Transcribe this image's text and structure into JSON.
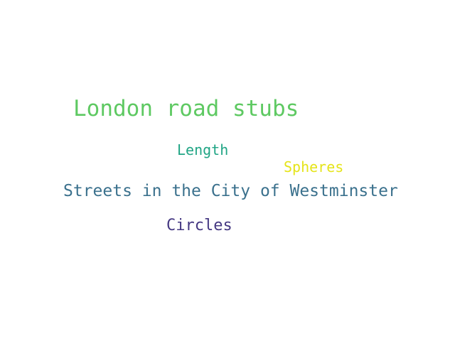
{
  "words": [
    {
      "text": "London road stubs",
      "color": "#5ec962"
    },
    {
      "text": "Length",
      "color": "#21a585"
    },
    {
      "text": "Spheres",
      "color": "#e5e419"
    },
    {
      "text": "Streets in the City of Westminster",
      "color": "#3b718d"
    },
    {
      "text": "Circles",
      "color": "#453882"
    }
  ]
}
